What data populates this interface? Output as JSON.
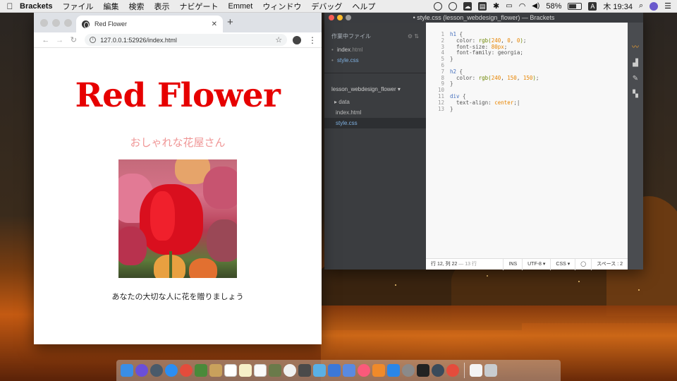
{
  "menubar": {
    "app_name": "Brackets",
    "menus": [
      "ファイル",
      "編集",
      "検索",
      "表示",
      "ナビゲート",
      "Emmet",
      "ウィンドウ",
      "デバッグ",
      "ヘルプ"
    ],
    "battery": "58%",
    "input_source": "A",
    "clock": "木 19:34"
  },
  "chrome": {
    "tab_title": "Red Flower",
    "url": "127.0.0.1:52926/index.html",
    "page": {
      "heading": "Red Flower",
      "subheading": "おしゃれな花屋さん",
      "caption": "あなたの大切な人に花を贈りましょう"
    }
  },
  "brackets": {
    "window_title": "• style.css (lesson_webdesign_flower) — Brackets",
    "working_files_label": "作業中ファイル",
    "working_files": [
      {
        "name": "index",
        "ext": ".html",
        "active": false
      },
      {
        "name": "style",
        "ext": ".css",
        "active": true
      }
    ],
    "project_name": "lesson_webdesign_flower ▾",
    "tree": [
      {
        "label": "▸ data",
        "child": false,
        "active": false
      },
      {
        "label": "index.html",
        "child": true,
        "active": false
      },
      {
        "label": "style.css",
        "child": true,
        "active": true
      }
    ],
    "line_numbers": [
      "1",
      "2",
      "3",
      "4",
      "5",
      "6",
      "7",
      "8",
      "9",
      "10",
      "11",
      "12",
      "13"
    ],
    "status": {
      "cursor": "行 12, 列 22",
      "lines": " — 13 行",
      "mode": "INS",
      "encoding": "UTF-8 ▾",
      "language": "CSS ▾",
      "indent": "スペース : 2"
    }
  },
  "colors": {
    "heading_red": "#e60000",
    "subheading_pink": "#f09696",
    "editor_bg": "#f8f8f8",
    "sidebar_bg": "#3b3d40"
  }
}
